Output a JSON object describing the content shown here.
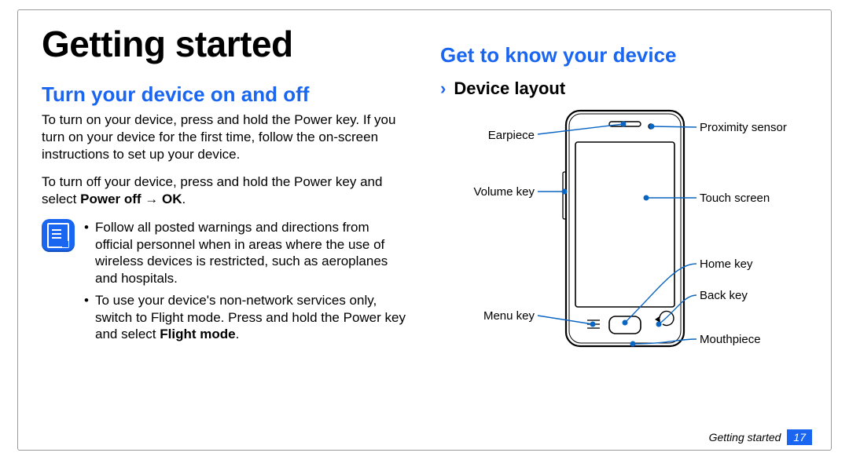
{
  "page_title": "Getting started",
  "section_turn": {
    "heading": "Turn your device on and off",
    "para1": "To turn on your device, press and hold the Power key. If you turn on your device for the first time, follow the on-screen instructions to set up your device.",
    "para2_pre": "To turn off your device, press and hold the Power key and select ",
    "para2_bold": "Power off → OK",
    "para2_post": ".",
    "notes": [
      "Follow all posted warnings and directions from official personnel when in areas where the use of wireless devices is restricted, such as aeroplanes and hospitals.",
      "To use your device's non-network services only, switch to Flight mode. Press and hold the Power key and select "
    ],
    "note2_bold": "Flight mode",
    "note2_post": "."
  },
  "section_know": {
    "heading": "Get to know your device",
    "sub_heading": "Device layout",
    "labels_left": {
      "earpiece": "Earpiece",
      "volume": "Volume key",
      "menu": "Menu key"
    },
    "labels_right": {
      "proximity": "Proximity sensor",
      "touch": "Touch screen",
      "home": "Home key",
      "back": "Back key",
      "mouth": "Mouthpiece"
    }
  },
  "footer": {
    "section": "Getting started",
    "page": "17"
  }
}
